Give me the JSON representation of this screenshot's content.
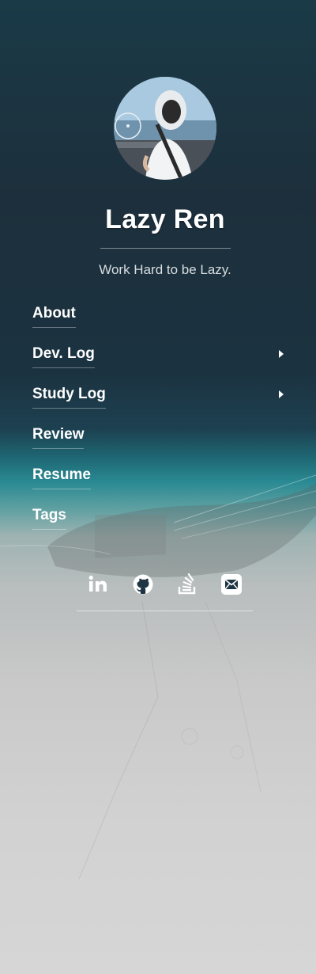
{
  "profile": {
    "name": "Lazy Ren",
    "tagline": "Work Hard to be Lazy."
  },
  "nav": {
    "items": [
      {
        "label": "About",
        "has_submenu": false
      },
      {
        "label": "Dev. Log",
        "has_submenu": true
      },
      {
        "label": "Study Log",
        "has_submenu": true
      },
      {
        "label": "Review",
        "has_submenu": false
      },
      {
        "label": "Resume",
        "has_submenu": false
      },
      {
        "label": "Tags",
        "has_submenu": false
      }
    ]
  },
  "social": {
    "links": [
      {
        "icon": "linkedin-icon"
      },
      {
        "icon": "github-icon"
      },
      {
        "icon": "stackoverflow-icon"
      },
      {
        "icon": "email-icon"
      }
    ]
  },
  "colors": {
    "sidebar_top": "#1d2f3c",
    "sea_teal": "#2a8a93",
    "fog_gray": "#d2d2d2",
    "text": "#ffffff",
    "tagline": "#d8dde0"
  }
}
